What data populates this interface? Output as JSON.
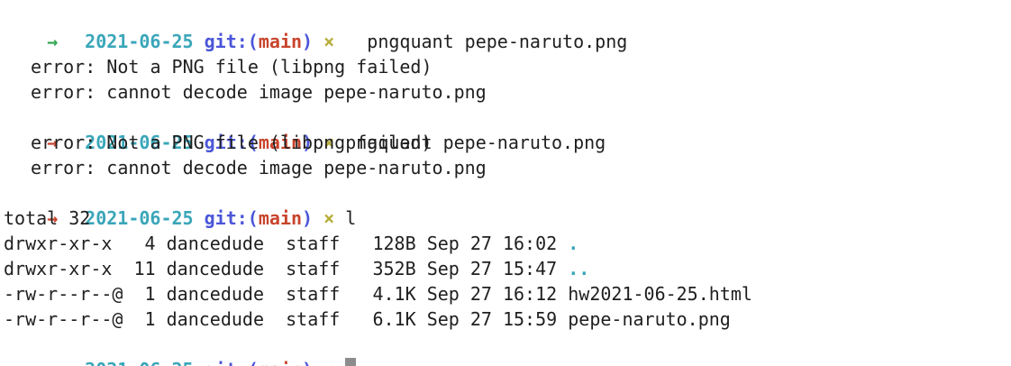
{
  "prompt": {
    "date": "2021-06-25",
    "git_label": "git:(",
    "branch": "main",
    "close": ")",
    "dirty": "×",
    "arrow": "→"
  },
  "commands": {
    "c1": "  pngquant pepe-naruto.png",
    "c2": "pngquant pepe-naruto.png",
    "c3": "l"
  },
  "errors": {
    "e1": "error: Not a PNG file (libpng failed)",
    "e2": "error: cannot decode image pepe-naruto.png"
  },
  "listing": {
    "total": "total 32",
    "rows": [
      {
        "perm": "drwxr-xr-x ",
        "links": " 4",
        "owner": "dancedude",
        "group": "staff",
        "size": " 128B",
        "date": "Sep 27 16:02",
        "name": "."
      },
      {
        "perm": "drwxr-xr-x ",
        "links": "11",
        "owner": "dancedude",
        "group": "staff",
        "size": " 352B",
        "date": "Sep 27 15:47",
        "name": ".."
      },
      {
        "perm": "-rw-r--r--@",
        "links": " 1",
        "owner": "dancedude",
        "group": "staff",
        "size": " 4.1K",
        "date": "Sep 27 16:12",
        "name": "hw2021-06-25.html"
      },
      {
        "perm": "-rw-r--r--@",
        "links": " 1",
        "owner": "dancedude",
        "group": "staff",
        "size": " 6.1K",
        "date": "Sep 27 15:59",
        "name": "pepe-naruto.png"
      }
    ]
  },
  "colors": {
    "arrow_success": "#36a854",
    "arrow_fail": "#c8442c",
    "date": "#3aa6b9",
    "git": "#4b56d8",
    "branch": "#c8442c",
    "dirty": "#b6ad39"
  }
}
